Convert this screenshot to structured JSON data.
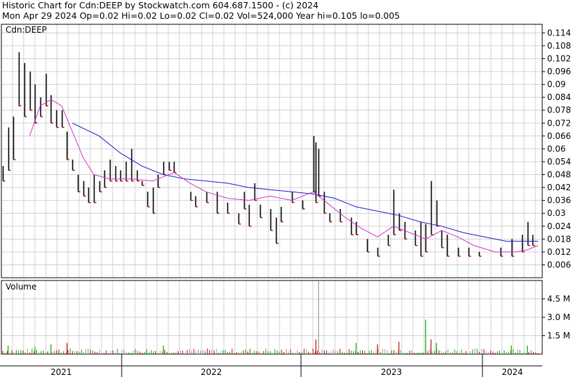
{
  "header": {
    "line1": "Historic Chart for Cdn:DEEP by Stockwatch.com 604.687.1500 - (c) 2024",
    "line2": "Mon Apr 29 2024  Op=0.02  Hi=0.02  Lo=0.02  Cl=0.02  Vol=524,000  Year hi=0.105  lo=0.005"
  },
  "chart_data": [
    {
      "type": "line",
      "title": "Cdn:DEEP",
      "ylabel": "",
      "xlabel": "",
      "ylim": [
        0,
        0.118
      ],
      "yticks": [
        "0.114",
        "0.108",
        "0.102",
        "0.096",
        "0.09",
        "0.084",
        "0.078",
        "0.072",
        "0.066",
        "0.06",
        "0.054",
        "0.048",
        "0.042",
        "0.036",
        "0.03",
        "0.024",
        "0.018",
        "0.012",
        "0.006"
      ],
      "ytick_values": [
        0.114,
        0.108,
        0.102,
        0.096,
        0.09,
        0.084,
        0.078,
        0.072,
        0.066,
        0.06,
        0.054,
        0.048,
        0.042,
        0.036,
        0.03,
        0.024,
        0.018,
        0.012,
        0.006
      ],
      "x_years": [
        "2021",
        "2022",
        "2023",
        "2024"
      ],
      "grid": true,
      "colors": {
        "price_bar": "#000000",
        "down_tick": "#cc0000",
        "ma_long": "#1a1acc",
        "ma_short": "#cc33cc"
      },
      "price_bars": [
        {
          "t": 0.0,
          "hi": 0.052,
          "lo": 0.045
        },
        {
          "t": 0.01,
          "hi": 0.07,
          "lo": 0.05
        },
        {
          "t": 0.02,
          "hi": 0.075,
          "lo": 0.055
        },
        {
          "t": 0.03,
          "hi": 0.105,
          "lo": 0.08
        },
        {
          "t": 0.04,
          "hi": 0.1,
          "lo": 0.075
        },
        {
          "t": 0.05,
          "hi": 0.096,
          "lo": 0.078
        },
        {
          "t": 0.06,
          "hi": 0.09,
          "lo": 0.072
        },
        {
          "t": 0.07,
          "hi": 0.084,
          "lo": 0.075
        },
        {
          "t": 0.08,
          "hi": 0.095,
          "lo": 0.08
        },
        {
          "t": 0.09,
          "hi": 0.085,
          "lo": 0.072
        },
        {
          "t": 0.1,
          "hi": 0.078,
          "lo": 0.07
        },
        {
          "t": 0.11,
          "hi": 0.078,
          "lo": 0.07
        },
        {
          "t": 0.12,
          "hi": 0.068,
          "lo": 0.055
        },
        {
          "t": 0.13,
          "hi": 0.055,
          "lo": 0.05
        },
        {
          "t": 0.14,
          "hi": 0.048,
          "lo": 0.04
        },
        {
          "t": 0.15,
          "hi": 0.045,
          "lo": 0.038
        },
        {
          "t": 0.16,
          "hi": 0.042,
          "lo": 0.035
        },
        {
          "t": 0.17,
          "hi": 0.048,
          "lo": 0.035
        },
        {
          "t": 0.18,
          "hi": 0.045,
          "lo": 0.04
        },
        {
          "t": 0.19,
          "hi": 0.05,
          "lo": 0.042
        },
        {
          "t": 0.2,
          "hi": 0.055,
          "lo": 0.045
        },
        {
          "t": 0.21,
          "hi": 0.052,
          "lo": 0.045
        },
        {
          "t": 0.22,
          "hi": 0.05,
          "lo": 0.045
        },
        {
          "t": 0.23,
          "hi": 0.054,
          "lo": 0.045
        },
        {
          "t": 0.24,
          "hi": 0.06,
          "lo": 0.045
        },
        {
          "t": 0.25,
          "hi": 0.05,
          "lo": 0.045
        },
        {
          "t": 0.26,
          "hi": 0.045,
          "lo": 0.043
        },
        {
          "t": 0.27,
          "hi": 0.04,
          "lo": 0.033
        },
        {
          "t": 0.28,
          "hi": 0.042,
          "lo": 0.03
        },
        {
          "t": 0.29,
          "hi": 0.048,
          "lo": 0.042
        },
        {
          "t": 0.3,
          "hi": 0.054,
          "lo": 0.048
        },
        {
          "t": 0.31,
          "hi": 0.054,
          "lo": 0.05
        },
        {
          "t": 0.32,
          "hi": 0.054,
          "lo": 0.049
        },
        {
          "t": 0.35,
          "hi": 0.04,
          "lo": 0.036
        },
        {
          "t": 0.36,
          "hi": 0.038,
          "lo": 0.033
        },
        {
          "t": 0.38,
          "hi": 0.04,
          "lo": 0.035
        },
        {
          "t": 0.4,
          "hi": 0.04,
          "lo": 0.03
        },
        {
          "t": 0.42,
          "hi": 0.035,
          "lo": 0.03
        },
        {
          "t": 0.44,
          "hi": 0.03,
          "lo": 0.025
        },
        {
          "t": 0.45,
          "hi": 0.04,
          "lo": 0.032
        },
        {
          "t": 0.46,
          "hi": 0.034,
          "lo": 0.024
        },
        {
          "t": 0.47,
          "hi": 0.044,
          "lo": 0.036
        },
        {
          "t": 0.48,
          "hi": 0.034,
          "lo": 0.028
        },
        {
          "t": 0.5,
          "hi": 0.032,
          "lo": 0.022
        },
        {
          "t": 0.51,
          "hi": 0.028,
          "lo": 0.016
        },
        {
          "t": 0.52,
          "hi": 0.033,
          "lo": 0.026
        },
        {
          "t": 0.54,
          "hi": 0.04,
          "lo": 0.035
        },
        {
          "t": 0.56,
          "hi": 0.036,
          "lo": 0.032
        },
        {
          "t": 0.58,
          "hi": 0.066,
          "lo": 0.04
        },
        {
          "t": 0.585,
          "hi": 0.063,
          "lo": 0.035
        },
        {
          "t": 0.59,
          "hi": 0.06,
          "lo": 0.038
        },
        {
          "t": 0.6,
          "hi": 0.04,
          "lo": 0.03
        },
        {
          "t": 0.61,
          "hi": 0.03,
          "lo": 0.026
        },
        {
          "t": 0.63,
          "hi": 0.032,
          "lo": 0.026
        },
        {
          "t": 0.65,
          "hi": 0.028,
          "lo": 0.02
        },
        {
          "t": 0.66,
          "hi": 0.026,
          "lo": 0.02
        },
        {
          "t": 0.68,
          "hi": 0.018,
          "lo": 0.012
        },
        {
          "t": 0.7,
          "hi": 0.014,
          "lo": 0.01
        },
        {
          "t": 0.72,
          "hi": 0.02,
          "lo": 0.015
        },
        {
          "t": 0.73,
          "hi": 0.041,
          "lo": 0.02
        },
        {
          "t": 0.74,
          "hi": 0.03,
          "lo": 0.022
        },
        {
          "t": 0.75,
          "hi": 0.026,
          "lo": 0.018
        },
        {
          "t": 0.77,
          "hi": 0.022,
          "lo": 0.015
        },
        {
          "t": 0.78,
          "hi": 0.026,
          "lo": 0.01
        },
        {
          "t": 0.79,
          "hi": 0.025,
          "lo": 0.012
        },
        {
          "t": 0.8,
          "hi": 0.045,
          "lo": 0.02
        },
        {
          "t": 0.81,
          "hi": 0.036,
          "lo": 0.024
        },
        {
          "t": 0.82,
          "hi": 0.022,
          "lo": 0.014
        },
        {
          "t": 0.83,
          "hi": 0.02,
          "lo": 0.01
        },
        {
          "t": 0.85,
          "hi": 0.014,
          "lo": 0.01
        },
        {
          "t": 0.87,
          "hi": 0.014,
          "lo": 0.01
        },
        {
          "t": 0.89,
          "hi": 0.012,
          "lo": 0.01
        },
        {
          "t": 0.93,
          "hi": 0.014,
          "lo": 0.01
        },
        {
          "t": 0.95,
          "hi": 0.018,
          "lo": 0.01
        },
        {
          "t": 0.97,
          "hi": 0.02,
          "lo": 0.012
        },
        {
          "t": 0.98,
          "hi": 0.026,
          "lo": 0.015
        },
        {
          "t": 0.99,
          "hi": 0.02,
          "lo": 0.015
        }
      ],
      "series": [
        {
          "role": "ma_long",
          "points": [
            [
              0.13,
              0.072
            ],
            [
              0.18,
              0.066
            ],
            [
              0.22,
              0.058
            ],
            [
              0.26,
              0.052
            ],
            [
              0.3,
              0.048
            ],
            [
              0.34,
              0.046
            ],
            [
              0.38,
              0.045
            ],
            [
              0.42,
              0.044
            ],
            [
              0.46,
              0.042
            ],
            [
              0.5,
              0.041
            ],
            [
              0.54,
              0.04
            ],
            [
              0.58,
              0.039
            ],
            [
              0.62,
              0.037
            ],
            [
              0.66,
              0.033
            ],
            [
              0.7,
              0.031
            ],
            [
              0.74,
              0.029
            ],
            [
              0.78,
              0.026
            ],
            [
              0.82,
              0.024
            ],
            [
              0.86,
              0.021
            ],
            [
              0.9,
              0.019
            ],
            [
              0.94,
              0.017
            ],
            [
              0.98,
              0.017
            ],
            [
              1.0,
              0.017
            ]
          ]
        },
        {
          "role": "ma_short",
          "points": [
            [
              0.05,
              0.066
            ],
            [
              0.07,
              0.08
            ],
            [
              0.09,
              0.083
            ],
            [
              0.11,
              0.08
            ],
            [
              0.13,
              0.068
            ],
            [
              0.15,
              0.056
            ],
            [
              0.17,
              0.048
            ],
            [
              0.2,
              0.046
            ],
            [
              0.24,
              0.046
            ],
            [
              0.28,
              0.045
            ],
            [
              0.32,
              0.049
            ],
            [
              0.35,
              0.044
            ],
            [
              0.38,
              0.04
            ],
            [
              0.42,
              0.037
            ],
            [
              0.46,
              0.036
            ],
            [
              0.5,
              0.038
            ],
            [
              0.54,
              0.036
            ],
            [
              0.58,
              0.04
            ],
            [
              0.61,
              0.034
            ],
            [
              0.64,
              0.028
            ],
            [
              0.67,
              0.023
            ],
            [
              0.7,
              0.019
            ],
            [
              0.73,
              0.024
            ],
            [
              0.76,
              0.021
            ],
            [
              0.79,
              0.018
            ],
            [
              0.82,
              0.022
            ],
            [
              0.85,
              0.019
            ],
            [
              0.88,
              0.015
            ],
            [
              0.92,
              0.012
            ],
            [
              0.96,
              0.012
            ],
            [
              0.98,
              0.013
            ],
            [
              1.0,
              0.015
            ]
          ]
        }
      ]
    },
    {
      "type": "bar",
      "title": "Volume",
      "ylim": [
        0,
        6000000
      ],
      "yticks": [
        "4.5 M",
        "3.0 M",
        "1.5 M"
      ],
      "ytick_values": [
        4500000,
        3000000,
        1500000
      ],
      "colors": {
        "up": "#00aa00",
        "down": "#cc0000",
        "flat": "#999999"
      },
      "spikes": [
        {
          "t": 0.59,
          "v": 6000000,
          "c": "flat"
        },
        {
          "t": 0.79,
          "v": 2800000,
          "c": "up"
        },
        {
          "t": 0.585,
          "v": 1200000,
          "c": "down"
        },
        {
          "t": 0.01,
          "v": 700000,
          "c": "up"
        },
        {
          "t": 0.06,
          "v": 600000,
          "c": "up"
        },
        {
          "t": 0.09,
          "v": 800000,
          "c": "up"
        },
        {
          "t": 0.12,
          "v": 900000,
          "c": "down"
        },
        {
          "t": 0.3,
          "v": 700000,
          "c": "up"
        },
        {
          "t": 0.66,
          "v": 900000,
          "c": "up"
        },
        {
          "t": 0.7,
          "v": 800000,
          "c": "down"
        },
        {
          "t": 0.74,
          "v": 1000000,
          "c": "down"
        },
        {
          "t": 0.8,
          "v": 1200000,
          "c": "down"
        },
        {
          "t": 0.81,
          "v": 900000,
          "c": "up"
        },
        {
          "t": 0.95,
          "v": 700000,
          "c": "up"
        },
        {
          "t": 0.98,
          "v": 700000,
          "c": "up"
        }
      ]
    }
  ]
}
